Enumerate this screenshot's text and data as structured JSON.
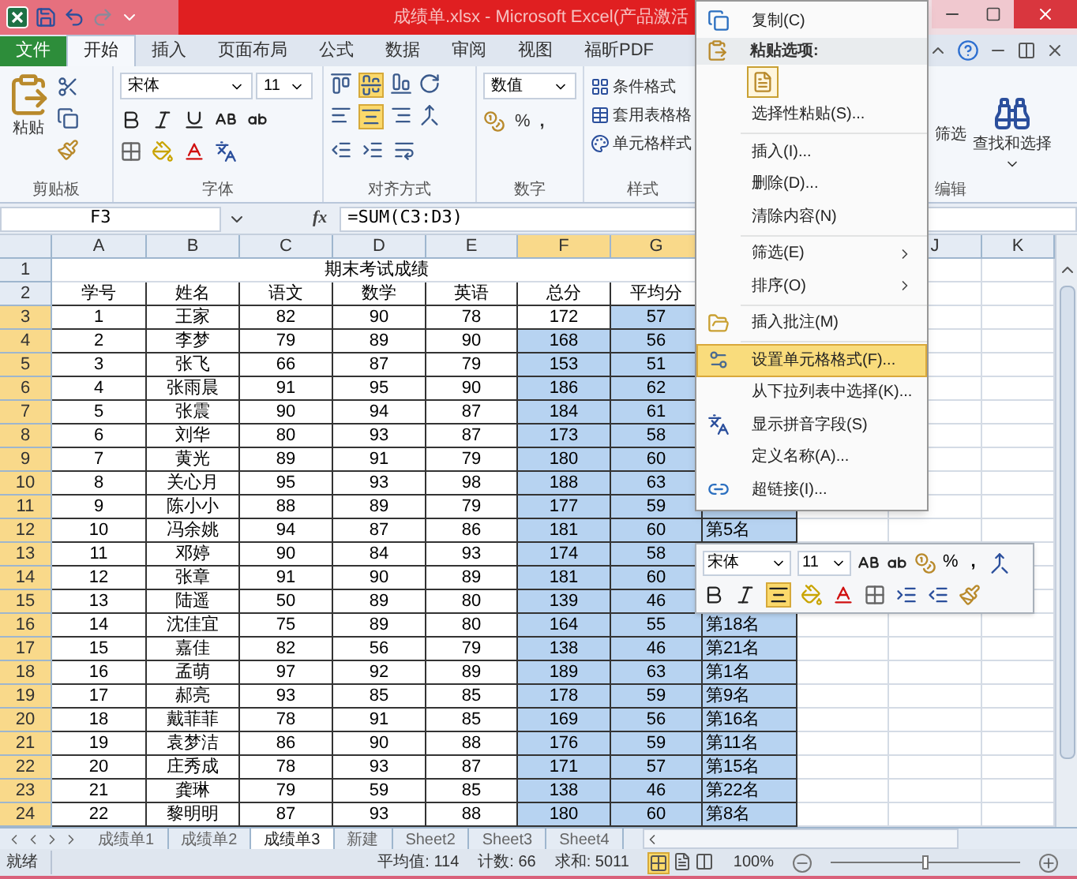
{
  "window": {
    "title": "成绩单.xlsx - Microsoft Excel(产品激活"
  },
  "ribbon_tabs": [
    {
      "label": "文件",
      "kind": "file",
      "selected": false
    },
    {
      "label": "开始",
      "kind": "tab",
      "selected": true
    },
    {
      "label": "插入",
      "kind": "tab",
      "selected": false
    },
    {
      "label": "页面布局",
      "kind": "tab",
      "selected": false
    },
    {
      "label": "公式",
      "kind": "tab",
      "selected": false
    },
    {
      "label": "数据",
      "kind": "tab",
      "selected": false
    },
    {
      "label": "审阅",
      "kind": "tab",
      "selected": false
    },
    {
      "label": "视图",
      "kind": "tab",
      "selected": false
    },
    {
      "label": "福昕PDF",
      "kind": "tab",
      "selected": false
    }
  ],
  "ribbon": {
    "clipboard": {
      "paste": "粘贴",
      "label": "剪贴板"
    },
    "font": {
      "name": "宋体",
      "size": "11",
      "label": "字体"
    },
    "alignment": {
      "label": "对齐方式",
      "middle_on": true,
      "center_on": true
    },
    "number": {
      "format": "数值",
      "percent": "%",
      "comma": ",",
      "label": "数字"
    },
    "styles": {
      "items": [
        "条件格式",
        "套用表格格",
        "单元格样式"
      ],
      "label": "样式"
    },
    "editing": {
      "filter": "筛选",
      "find": "查找和选择",
      "label": "编辑"
    }
  },
  "formula_bar": {
    "cell": "F3",
    "fx": "fx",
    "formula": "=SUM(C3:D3)"
  },
  "columns": [
    {
      "label": "A",
      "selected": false
    },
    {
      "label": "B",
      "selected": false
    },
    {
      "label": "C",
      "selected": false
    },
    {
      "label": "D",
      "selected": false
    },
    {
      "label": "E",
      "selected": false
    },
    {
      "label": "F",
      "selected": true
    },
    {
      "label": "G",
      "selected": true
    },
    {
      "selected": true
    },
    {
      "label": "J",
      "selected": false
    },
    {
      "label": "K",
      "selected": false
    }
  ],
  "title_row": {
    "number": "1",
    "title": "期末考试成绩"
  },
  "header_row": {
    "number": "2",
    "cells": [
      "学号",
      "姓名",
      "语文",
      "数学",
      "英语",
      "总分",
      "平均分"
    ]
  },
  "rows": [
    {
      "number": "3",
      "selected": true,
      "active": true,
      "cells": [
        "1",
        "王家",
        "82",
        "90",
        "78",
        "172",
        "57"
      ]
    },
    {
      "number": "4",
      "selected": true,
      "active": false,
      "cells": [
        "2",
        "李梦",
        "79",
        "89",
        "90",
        "168",
        "56"
      ]
    },
    {
      "number": "5",
      "selected": true,
      "active": false,
      "cells": [
        "3",
        "张飞",
        "66",
        "87",
        "79",
        "153",
        "51"
      ]
    },
    {
      "number": "6",
      "selected": true,
      "active": false,
      "cells": [
        "4",
        "张雨晨",
        "91",
        "95",
        "90",
        "186",
        "62"
      ]
    },
    {
      "number": "7",
      "selected": true,
      "active": false,
      "cells": [
        "5",
        "张震",
        "90",
        "94",
        "87",
        "184",
        "61"
      ]
    },
    {
      "number": "8",
      "selected": true,
      "active": false,
      "cells": [
        "6",
        "刘华",
        "80",
        "93",
        "87",
        "173",
        "58"
      ]
    },
    {
      "number": "9",
      "selected": true,
      "active": false,
      "cells": [
        "7",
        "黄光",
        "89",
        "91",
        "79",
        "180",
        "60"
      ]
    },
    {
      "number": "10",
      "selected": true,
      "active": false,
      "cells": [
        "8",
        "关心月",
        "95",
        "93",
        "98",
        "188",
        "63"
      ]
    },
    {
      "number": "11",
      "selected": true,
      "active": false,
      "cells": [
        "9",
        "陈小小",
        "88",
        "89",
        "79",
        "177",
        "59"
      ]
    },
    {
      "number": "12",
      "selected": true,
      "active": false,
      "cells": [
        "10",
        "冯余姚",
        "94",
        "87",
        "86",
        "181",
        "60"
      ],
      "rank": "第5名"
    },
    {
      "number": "13",
      "selected": true,
      "active": false,
      "cells": [
        "11",
        "邓婷",
        "90",
        "84",
        "93",
        "174",
        "58"
      ]
    },
    {
      "number": "14",
      "selected": true,
      "active": false,
      "cells": [
        "12",
        "张章",
        "91",
        "90",
        "89",
        "181",
        "60"
      ]
    },
    {
      "number": "15",
      "selected": true,
      "active": false,
      "cells": [
        "13",
        "陆遥",
        "50",
        "89",
        "80",
        "139",
        "46"
      ]
    },
    {
      "number": "16",
      "selected": true,
      "active": false,
      "cells": [
        "14",
        "沈佳宜",
        "75",
        "89",
        "80",
        "164",
        "55"
      ],
      "rank": "第18名"
    },
    {
      "number": "17",
      "selected": true,
      "active": false,
      "cells": [
        "15",
        "嘉佳",
        "82",
        "56",
        "79",
        "138",
        "46"
      ],
      "rank": "第21名"
    },
    {
      "number": "18",
      "selected": true,
      "active": false,
      "cells": [
        "16",
        "孟萌",
        "97",
        "92",
        "89",
        "189",
        "63"
      ],
      "rank": "第1名"
    },
    {
      "number": "19",
      "selected": true,
      "active": false,
      "cells": [
        "17",
        "郝亮",
        "93",
        "85",
        "85",
        "178",
        "59"
      ],
      "rank": "第9名"
    },
    {
      "number": "20",
      "selected": true,
      "active": false,
      "cells": [
        "18",
        "戴菲菲",
        "78",
        "91",
        "85",
        "169",
        "56"
      ],
      "rank": "第16名"
    },
    {
      "number": "21",
      "selected": true,
      "active": false,
      "cells": [
        "19",
        "袁梦洁",
        "86",
        "90",
        "88",
        "176",
        "59"
      ],
      "rank": "第11名"
    },
    {
      "number": "22",
      "selected": true,
      "active": false,
      "cells": [
        "20",
        "庄秀成",
        "78",
        "93",
        "87",
        "171",
        "57"
      ],
      "rank": "第15名"
    },
    {
      "number": "23",
      "selected": true,
      "active": false,
      "cells": [
        "21",
        "龚琳",
        "79",
        "59",
        "85",
        "138",
        "46"
      ],
      "rank": "第22名"
    },
    {
      "number": "24",
      "selected": true,
      "active": false,
      "cells": [
        "22",
        "黎明明",
        "87",
        "93",
        "88",
        "180",
        "60"
      ],
      "rank": "第8名"
    }
  ],
  "sheet_tabs": [
    {
      "label": "成绩单1",
      "selected": false
    },
    {
      "label": "成绩单2",
      "selected": false
    },
    {
      "label": "成绩单3",
      "selected": true
    },
    {
      "label": "新建",
      "selected": false
    },
    {
      "label": "Sheet2",
      "selected": false
    },
    {
      "label": "Sheet3",
      "selected": false
    },
    {
      "label": "Sheet4",
      "selected": false
    }
  ],
  "status_bar": {
    "ready": "就绪",
    "average": "平均值: 114",
    "count": "计数: 66",
    "sum": "求和: 5011",
    "zoom": "100%",
    "zoom_slider": {
      "level": 0.5
    }
  },
  "context_menu": [
    {
      "kind": "item",
      "label": "复制(C)",
      "selected": false
    },
    {
      "kind": "header",
      "label": "粘贴选项:"
    },
    {
      "kind": "paste_options"
    },
    {
      "kind": "item",
      "label": "选择性粘贴(S)...",
      "selected": false
    },
    {
      "kind": "separator"
    },
    {
      "kind": "item",
      "label": "插入(I)...",
      "selected": false
    },
    {
      "kind": "item",
      "label": "删除(D)...",
      "selected": false
    },
    {
      "kind": "item",
      "label": "清除内容(N)",
      "selected": false
    },
    {
      "kind": "separator"
    },
    {
      "kind": "item",
      "label": "筛选(E)",
      "submenu": true,
      "selected": false
    },
    {
      "kind": "item",
      "label": "排序(O)",
      "submenu": true,
      "selected": false
    },
    {
      "kind": "separator"
    },
    {
      "kind": "item",
      "label": "插入批注(M)",
      "selected": false
    },
    {
      "kind": "separator"
    },
    {
      "kind": "item",
      "label": "设置单元格格式(F)...",
      "selected": true
    },
    {
      "kind": "item",
      "label": "从下拉列表中选择(K)...",
      "selected": false
    },
    {
      "kind": "item",
      "label": "显示拼音字段(S)",
      "selected": false
    },
    {
      "kind": "item",
      "label": "定义名称(A)...",
      "selected": false
    },
    {
      "kind": "item",
      "label": "超链接(I)...",
      "selected": false
    }
  ],
  "mini_toolbar": {
    "font": "宋体",
    "size": "11",
    "percent": "%",
    "comma": ",",
    "center_on": true
  }
}
